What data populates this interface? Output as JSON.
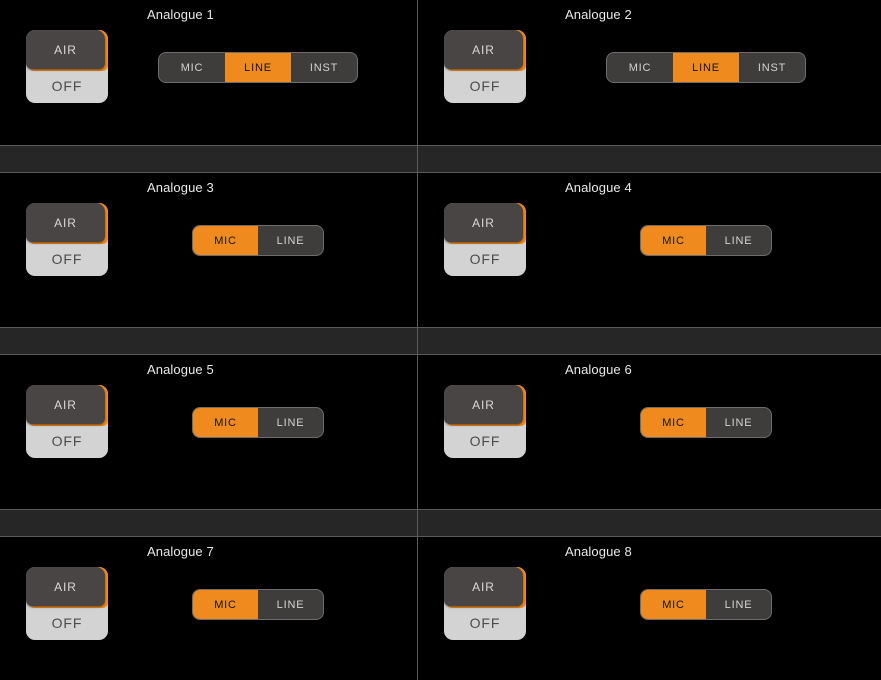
{
  "window": {
    "background": "#000000",
    "accent": "#ef8a1f",
    "divider_color": "#5a5a5a",
    "separator_color": "#262626"
  },
  "layout": {
    "columns": 2,
    "rows": 4,
    "channel_count": 8
  },
  "air_control": {
    "button_label": "AIR",
    "state_label": "OFF"
  },
  "channels": [
    {
      "title": "Analogue 1",
      "air": {
        "button_label": "AIR",
        "state_label": "OFF",
        "state": "OFF"
      },
      "input_type": {
        "options": [
          "MIC",
          "LINE",
          "INST"
        ],
        "selected": "LINE"
      }
    },
    {
      "title": "Analogue 2",
      "air": {
        "button_label": "AIR",
        "state_label": "OFF",
        "state": "OFF"
      },
      "input_type": {
        "options": [
          "MIC",
          "LINE",
          "INST"
        ],
        "selected": "LINE"
      }
    },
    {
      "title": "Analogue 3",
      "air": {
        "button_label": "AIR",
        "state_label": "OFF",
        "state": "OFF"
      },
      "input_type": {
        "options": [
          "MIC",
          "LINE"
        ],
        "selected": "MIC"
      }
    },
    {
      "title": "Analogue 4",
      "air": {
        "button_label": "AIR",
        "state_label": "OFF",
        "state": "OFF"
      },
      "input_type": {
        "options": [
          "MIC",
          "LINE"
        ],
        "selected": "MIC"
      }
    },
    {
      "title": "Analogue 5",
      "air": {
        "button_label": "AIR",
        "state_label": "OFF",
        "state": "OFF"
      },
      "input_type": {
        "options": [
          "MIC",
          "LINE"
        ],
        "selected": "MIC"
      }
    },
    {
      "title": "Analogue 6",
      "air": {
        "button_label": "AIR",
        "state_label": "OFF",
        "state": "OFF"
      },
      "input_type": {
        "options": [
          "MIC",
          "LINE"
        ],
        "selected": "MIC"
      }
    },
    {
      "title": "Analogue 7",
      "air": {
        "button_label": "AIR",
        "state_label": "OFF",
        "state": "OFF"
      },
      "input_type": {
        "options": [
          "MIC",
          "LINE"
        ],
        "selected": "MIC"
      }
    },
    {
      "title": "Analogue 8",
      "air": {
        "button_label": "AIR",
        "state_label": "OFF",
        "state": "OFF"
      },
      "input_type": {
        "options": [
          "MIC",
          "LINE"
        ],
        "selected": "MIC"
      }
    }
  ]
}
